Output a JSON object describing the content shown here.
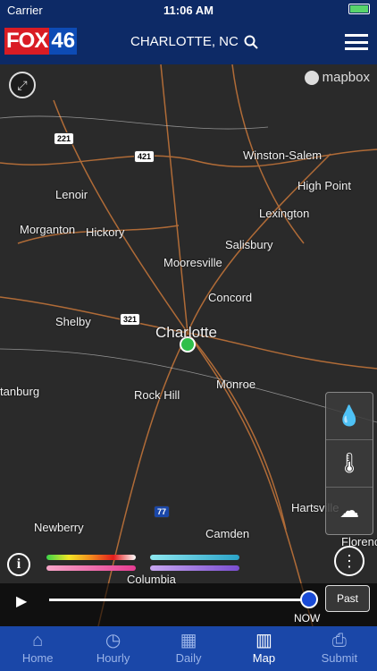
{
  "status": {
    "carrier": "Carrier",
    "time": "11:06 AM"
  },
  "header": {
    "logo_fox": "FOX",
    "logo_num": "46",
    "location": "CHARLOTTE, NC"
  },
  "map": {
    "attribution": "mapbox",
    "cities": [
      {
        "name": "Winston-Salem"
      },
      {
        "name": "High Point"
      },
      {
        "name": "Lenoir"
      },
      {
        "name": "Lexington"
      },
      {
        "name": "Morganton"
      },
      {
        "name": "Hickory"
      },
      {
        "name": "Salisbury"
      },
      {
        "name": "Mooresville"
      },
      {
        "name": "Concord"
      },
      {
        "name": "Shelby"
      },
      {
        "name": "Charlotte"
      },
      {
        "name": "tanburg"
      },
      {
        "name": "Rock Hill"
      },
      {
        "name": "Monroe"
      },
      {
        "name": "Hartsville"
      },
      {
        "name": "Newberry"
      },
      {
        "name": "Camden"
      },
      {
        "name": "Columbia"
      },
      {
        "name": "Florence"
      }
    ],
    "highways": [
      "221",
      "421",
      "321",
      "77"
    ]
  },
  "player": {
    "past_label": "Past",
    "now_label": "NOW"
  },
  "tabs": [
    {
      "label": "Home"
    },
    {
      "label": "Hourly"
    },
    {
      "label": "Daily"
    },
    {
      "label": "Map"
    },
    {
      "label": "Submit"
    }
  ],
  "colors": {
    "header": "#0d2a66",
    "tabbar": "#1a47a8",
    "accent": "#1a4bd6",
    "location_dot": "#2fbf4a"
  }
}
